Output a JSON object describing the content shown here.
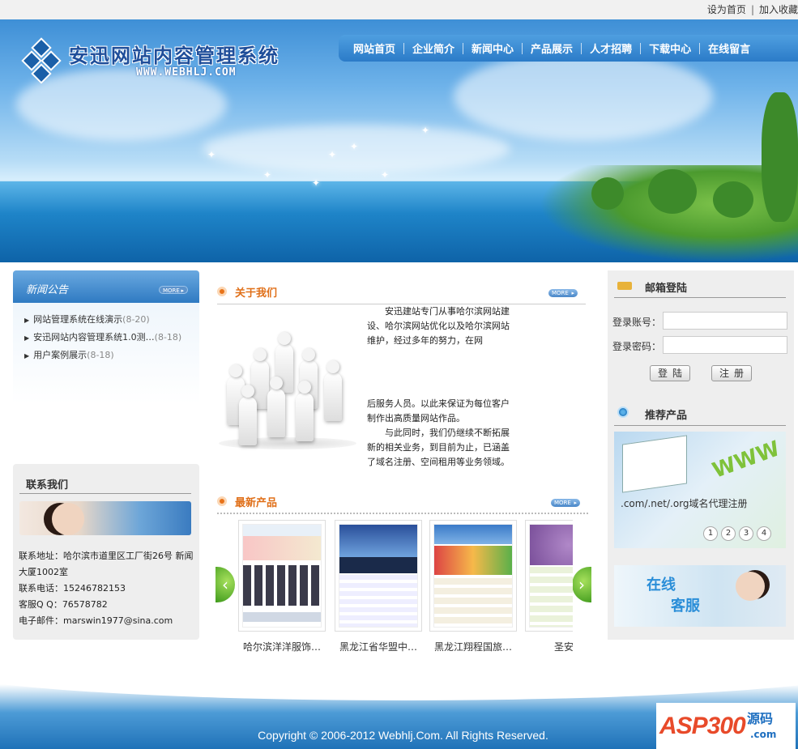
{
  "topbar": {
    "set_home": "设为首页",
    "separator": "|",
    "add_fav": "加入收藏"
  },
  "logo": {
    "title": "安迅网站内容管理系统",
    "url": "WWW.WEBHLJ.COM"
  },
  "nav": [
    "网站首页",
    "企业简介",
    "新闻中心",
    "产品展示",
    "人才招聘",
    "下载中心",
    "在线留言"
  ],
  "more_label": "MORE",
  "news": {
    "title": "新闻公告",
    "items": [
      {
        "title": "网站管理系统在线演示",
        "date": "(8-20)"
      },
      {
        "title": "安迅网站内容管理系统1.0测…",
        "date": "(8-18)"
      },
      {
        "title": "用户案例展示",
        "date": "(8-18)"
      }
    ]
  },
  "contact": {
    "title": "联系我们",
    "lines": [
      "联系地址：哈尔滨市道里区工厂街26号 新闻大厦1002室",
      "联系电话：15246782153",
      "客服Q Q：76578782",
      "电子邮件：marswin1977@sina.com"
    ]
  },
  "about": {
    "title": "关于我们",
    "para1": "安迅建站专门从事哈尔滨网站建设、哈尔滨网站优化以及哈尔滨网站维护，经过多年的努力，在网",
    "para1b": "后服务人员。以此来保证为每位客户制作出高质量网站作品。",
    "para2": "与此同时，我们仍继续不断拓展新的相关业务，到目前为止，已涵盖了域名注册、空间租用等业务领域。"
  },
  "products": {
    "title": "最新产品",
    "items": [
      {
        "caption": "哈尔滨洋洋服饰…"
      },
      {
        "caption": "黑龙江省华盟中…"
      },
      {
        "caption": "黑龙江翔程国旅…"
      },
      {
        "caption": "圣安琪"
      }
    ],
    "prev_icon": "chevron-left-icon",
    "next_icon": "chevron-right-icon"
  },
  "login": {
    "title": "邮箱登陆",
    "account_label": "登录账号：",
    "password_label": "登录密码：",
    "login_btn": "登陆",
    "register_btn": "注册"
  },
  "recommend": {
    "title": "推荐产品",
    "ad_text": ".com/.net/.org域名代理注册",
    "pages": [
      "1",
      "2",
      "3",
      "4"
    ],
    "service_text": [
      "在线",
      "客服"
    ]
  },
  "footer": {
    "copyright": "Copyright © 2006-2012 Webhlj.Com. All Rights Reserved."
  },
  "watermark": {
    "brand": "ASP300",
    "cn": "源码",
    "domain": ".com"
  },
  "colors": {
    "nav_blue": "#2b7bc8",
    "accent_orange": "#e0701a",
    "panel_gray": "#eeeeee"
  }
}
